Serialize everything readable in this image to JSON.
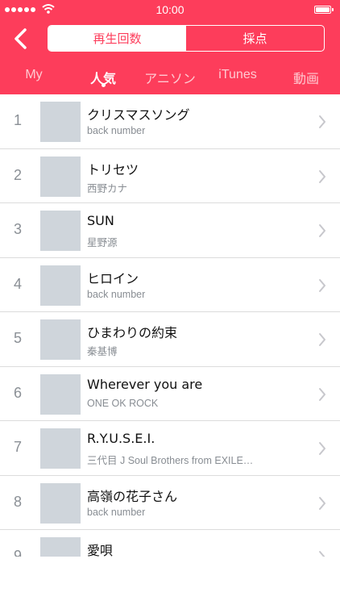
{
  "status_bar": {
    "time": "10:00"
  },
  "header": {
    "back_icon": "chevron-left-icon",
    "segments": [
      {
        "label": "再生回数",
        "selected": true
      },
      {
        "label": "採点",
        "selected": false
      }
    ],
    "accent_color": "#fd3d5b"
  },
  "tabs": [
    {
      "label": "My",
      "active": false
    },
    {
      "label": "人気",
      "active": true
    },
    {
      "label": "アニソン",
      "active": false
    },
    {
      "label": "iTunes",
      "active": false
    },
    {
      "label": "動画",
      "active": false
    }
  ],
  "songs": [
    {
      "rank": "1",
      "title": "クリスマスソング",
      "artist": "back number"
    },
    {
      "rank": "2",
      "title": "トリセツ",
      "artist": "西野カナ"
    },
    {
      "rank": "3",
      "title": "SUN",
      "artist": "星野源"
    },
    {
      "rank": "4",
      "title": "ヒロイン",
      "artist": "back number"
    },
    {
      "rank": "5",
      "title": "ひまわりの約束",
      "artist": "秦基博"
    },
    {
      "rank": "6",
      "title": "Wherever you are",
      "artist": "ONE OK ROCK"
    },
    {
      "rank": "7",
      "title": "R.Y.U.S.E.I.",
      "artist": "三代目 J Soul Brothers from EXILE…"
    },
    {
      "rank": "8",
      "title": "高嶺の花子さん",
      "artist": "back number"
    },
    {
      "rank": "9",
      "title": "愛唄",
      "artist": ""
    }
  ]
}
